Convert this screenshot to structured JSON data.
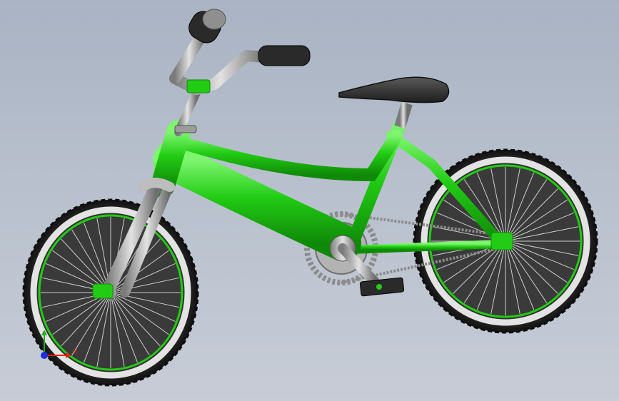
{
  "viewport": {
    "background_top": "#a9b3c3",
    "background_bottom": "#c7ccd6"
  },
  "model": {
    "subject": "bicycle",
    "colors": {
      "frame": "#22cc14",
      "frame_dark": "#0f8a08",
      "frame_light": "#7df56e",
      "metal": "#b9b9b9",
      "metal_dark": "#6e6e6e",
      "tire": "#1c1c1c",
      "tire_tread": "#2c2c2c",
      "rim": "#d9d9d9",
      "rim_accent": "#22cc14",
      "saddle": "#333333",
      "grip": "#2a2a2a"
    },
    "icons": [
      "front-wheel",
      "rear-wheel",
      "frame",
      "fork",
      "handlebar",
      "saddle",
      "crankset",
      "pedal",
      "chain"
    ]
  },
  "triad": {
    "x_label": "X",
    "colors": {
      "x": "#e0201a",
      "y": "#1fae1f",
      "z": "#1a2ee0"
    }
  }
}
